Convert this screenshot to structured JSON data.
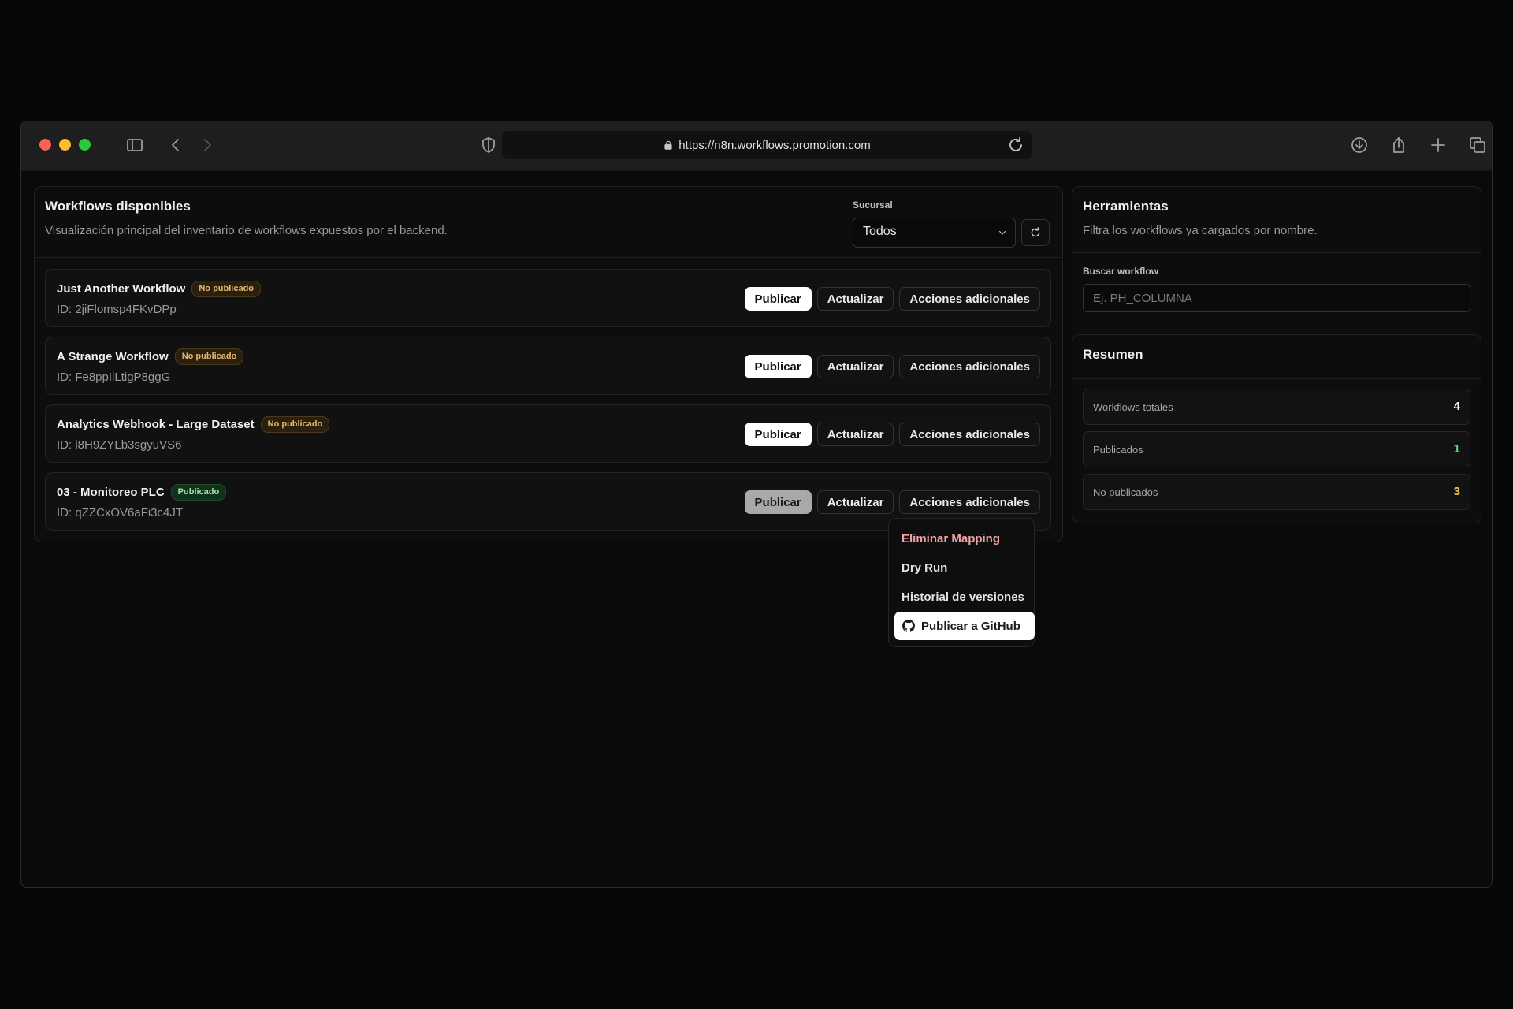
{
  "browser": {
    "url": "https://n8n.workflows.promotion.com"
  },
  "main": {
    "title": "Workflows disponibles",
    "subtitle": "Visualización principal del inventario de workflows expuestos por el backend.",
    "branch_label": "Sucursal",
    "branch_value": "Todos",
    "workflows": [
      {
        "name": "Just Another Workflow",
        "status": "No publicado",
        "id": "ID: 2jiFlomsp4FKvDPp"
      },
      {
        "name": "A Strange Workflow",
        "status": "No publicado",
        "id": "ID: Fe8ppIlLtigP8ggG"
      },
      {
        "name": "Analytics Webhook - Large Dataset",
        "status": "No publicado",
        "id": "ID: i8H9ZYLb3sgyuVS6"
      },
      {
        "name": "03 - Monitoreo PLC",
        "status": "Publicado",
        "id": "ID: qZZCxOV6aFi3c4JT"
      }
    ],
    "buttons": {
      "publish": "Publicar",
      "update": "Actualizar",
      "more": "Acciones adicionales"
    }
  },
  "dropdown": {
    "items": [
      "Eliminar Mapping",
      "Dry Run",
      "Historial de versiones"
    ],
    "github": "Publicar a GitHub"
  },
  "tools": {
    "title": "Herramientas",
    "subtitle": "Filtra los workflows ya cargados por nombre.",
    "search_label": "Buscar workflow",
    "search_placeholder": "Ej. PH_COLUMNA"
  },
  "summary": {
    "title": "Resumen",
    "rows": [
      {
        "label": "Workflows totales",
        "value": "4",
        "color": "#ffffff"
      },
      {
        "label": "Publicados",
        "value": "1",
        "color": "#5fd37a"
      },
      {
        "label": "No publicados",
        "value": "3",
        "color": "#f0c04a"
      }
    ]
  },
  "colors": {
    "accent_published": "#5fd37a",
    "accent_unpublished": "#f0c04a",
    "danger": "#f2a3a3"
  }
}
